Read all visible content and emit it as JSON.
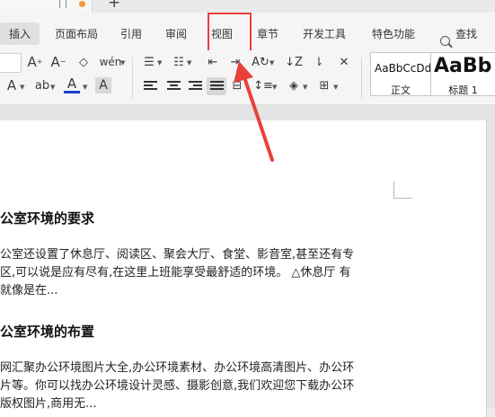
{
  "menu": {
    "tabs": [
      {
        "label": "插入"
      },
      {
        "label": "页面布局"
      },
      {
        "label": "引用"
      },
      {
        "label": "审阅"
      },
      {
        "label": "视图"
      },
      {
        "label": "章节"
      },
      {
        "label": "开发工具"
      },
      {
        "label": "特色功能"
      }
    ],
    "search_label": "查找"
  },
  "toolbar": {
    "font_color_glyph": "A",
    "styles": [
      {
        "preview": "AaBbCcDd",
        "name": "正文"
      },
      {
        "preview": "AaBb",
        "name": "标题 1"
      }
    ]
  },
  "document": {
    "blocks": [
      {
        "type": "heading",
        "text": "公室环境的要求"
      },
      {
        "type": "para",
        "lines": [
          "公室还设置了休息厅、阅读区、聚会大厅、食堂、影音室,甚至还有专",
          "区,可以说是应有尽有,在这里上班能享受最舒适的环境。 △休息厅  有",
          "就像是在..."
        ]
      },
      {
        "type": "heading",
        "text": "公室环境的布置"
      },
      {
        "type": "para",
        "lines": [
          "网汇聚办公环境图片大全,办公环境素材、办公环境高清图片、办公环",
          "片等。你可以找办公环境设计灵感、摄影创意,我们欢迎您下载办公环",
          "版权图片,商用无..."
        ]
      }
    ]
  },
  "colors": {
    "highlight": "#e8403b",
    "arrow": "#e8403b",
    "font_color_bar": "#1f3fd1"
  }
}
